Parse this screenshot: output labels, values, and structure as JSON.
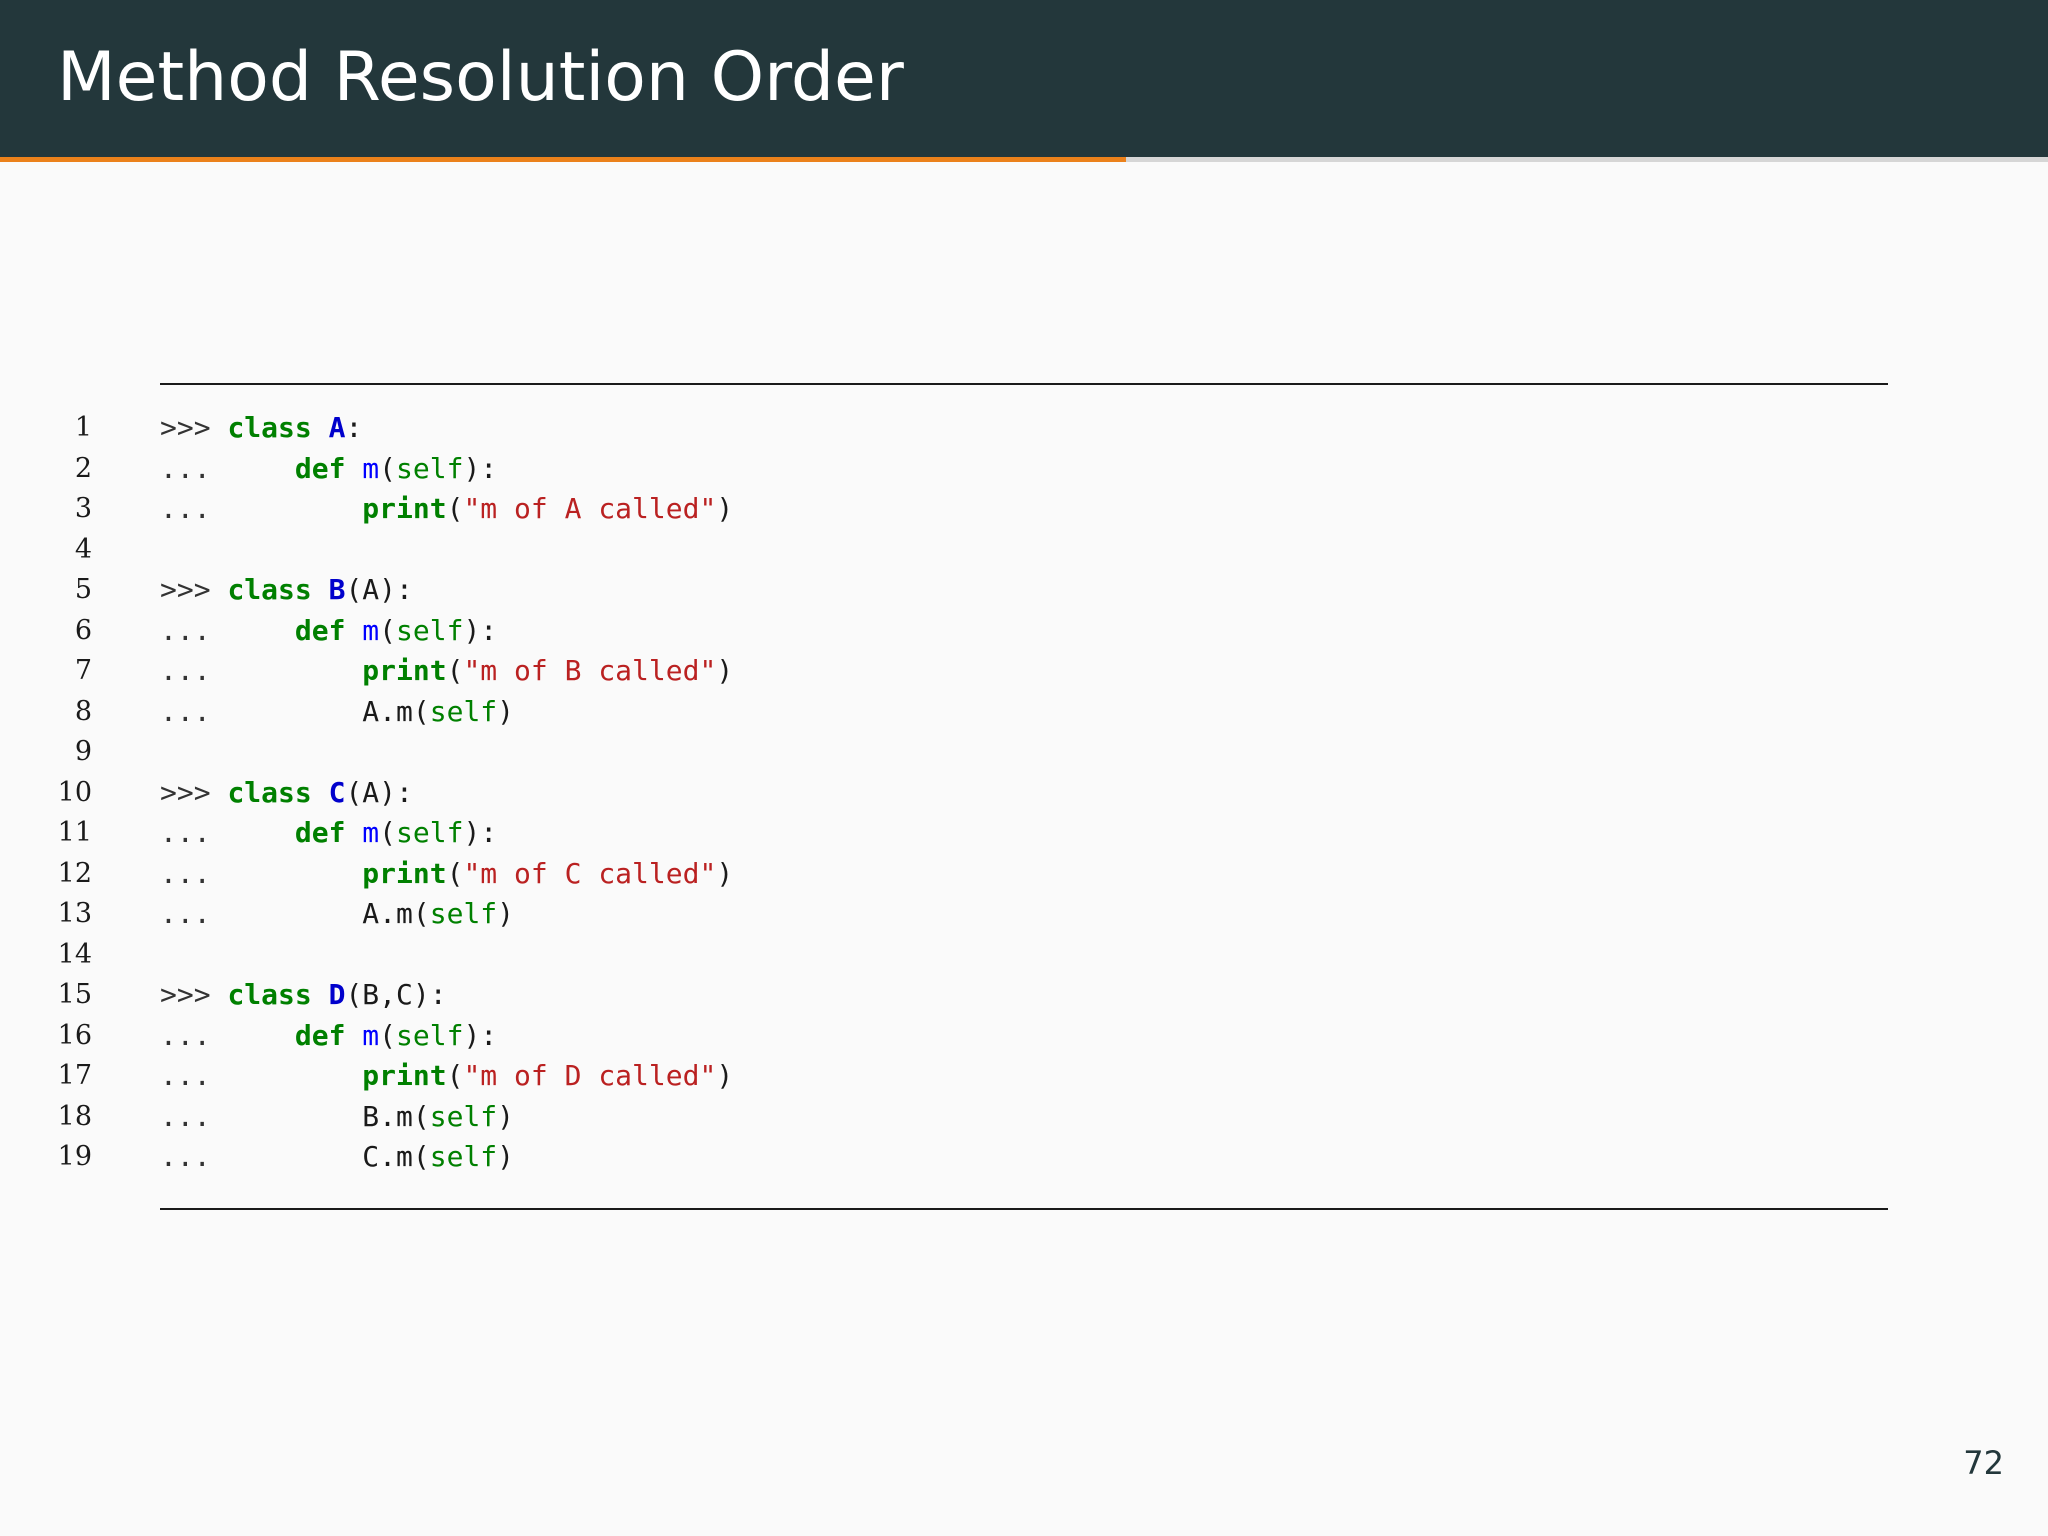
{
  "slide": {
    "title": "Method Resolution Order",
    "page_number": "72",
    "progress": 0.55,
    "colors": {
      "header_bg": "#23373b",
      "accent": "#eb811b",
      "background": "#fafafa"
    }
  },
  "code": {
    "language": "python",
    "lines": [
      {
        "num": "1",
        "tokens": [
          {
            "t": "prompt",
            "v": ">>> "
          },
          {
            "t": "kw",
            "v": "class"
          },
          {
            "t": "plain",
            "v": " "
          },
          {
            "t": "clsname",
            "v": "A"
          },
          {
            "t": "plain",
            "v": ":"
          }
        ]
      },
      {
        "num": "2",
        "tokens": [
          {
            "t": "prompt",
            "v": "...     "
          },
          {
            "t": "kw",
            "v": "def"
          },
          {
            "t": "plain",
            "v": " "
          },
          {
            "t": "name",
            "v": "m"
          },
          {
            "t": "plain",
            "v": "("
          },
          {
            "t": "builtin",
            "v": "self"
          },
          {
            "t": "plain",
            "v": "):"
          }
        ]
      },
      {
        "num": "3",
        "tokens": [
          {
            "t": "prompt",
            "v": "...         "
          },
          {
            "t": "kw",
            "v": "print"
          },
          {
            "t": "plain",
            "v": "("
          },
          {
            "t": "str",
            "v": "\"m of A called\""
          },
          {
            "t": "plain",
            "v": ")"
          }
        ]
      },
      {
        "num": "4",
        "tokens": []
      },
      {
        "num": "5",
        "tokens": [
          {
            "t": "prompt",
            "v": ">>> "
          },
          {
            "t": "kw",
            "v": "class"
          },
          {
            "t": "plain",
            "v": " "
          },
          {
            "t": "clsname",
            "v": "B"
          },
          {
            "t": "plain",
            "v": "(A):"
          }
        ]
      },
      {
        "num": "6",
        "tokens": [
          {
            "t": "prompt",
            "v": "...     "
          },
          {
            "t": "kw",
            "v": "def"
          },
          {
            "t": "plain",
            "v": " "
          },
          {
            "t": "name",
            "v": "m"
          },
          {
            "t": "plain",
            "v": "("
          },
          {
            "t": "builtin",
            "v": "self"
          },
          {
            "t": "plain",
            "v": "):"
          }
        ]
      },
      {
        "num": "7",
        "tokens": [
          {
            "t": "prompt",
            "v": "...         "
          },
          {
            "t": "kw",
            "v": "print"
          },
          {
            "t": "plain",
            "v": "("
          },
          {
            "t": "str",
            "v": "\"m of B called\""
          },
          {
            "t": "plain",
            "v": ")"
          }
        ]
      },
      {
        "num": "8",
        "tokens": [
          {
            "t": "prompt",
            "v": "...         "
          },
          {
            "t": "plain",
            "v": "A.m("
          },
          {
            "t": "builtin",
            "v": "self"
          },
          {
            "t": "plain",
            "v": ")"
          }
        ]
      },
      {
        "num": "9",
        "tokens": []
      },
      {
        "num": "10",
        "tokens": [
          {
            "t": "prompt",
            "v": ">>> "
          },
          {
            "t": "kw",
            "v": "class"
          },
          {
            "t": "plain",
            "v": " "
          },
          {
            "t": "clsname",
            "v": "C"
          },
          {
            "t": "plain",
            "v": "(A):"
          }
        ]
      },
      {
        "num": "11",
        "tokens": [
          {
            "t": "prompt",
            "v": "...     "
          },
          {
            "t": "kw",
            "v": "def"
          },
          {
            "t": "plain",
            "v": " "
          },
          {
            "t": "name",
            "v": "m"
          },
          {
            "t": "plain",
            "v": "("
          },
          {
            "t": "builtin",
            "v": "self"
          },
          {
            "t": "plain",
            "v": "):"
          }
        ]
      },
      {
        "num": "12",
        "tokens": [
          {
            "t": "prompt",
            "v": "...         "
          },
          {
            "t": "kw",
            "v": "print"
          },
          {
            "t": "plain",
            "v": "("
          },
          {
            "t": "str",
            "v": "\"m of C called\""
          },
          {
            "t": "plain",
            "v": ")"
          }
        ]
      },
      {
        "num": "13",
        "tokens": [
          {
            "t": "prompt",
            "v": "...         "
          },
          {
            "t": "plain",
            "v": "A.m("
          },
          {
            "t": "builtin",
            "v": "self"
          },
          {
            "t": "plain",
            "v": ")"
          }
        ]
      },
      {
        "num": "14",
        "tokens": []
      },
      {
        "num": "15",
        "tokens": [
          {
            "t": "prompt",
            "v": ">>> "
          },
          {
            "t": "kw",
            "v": "class"
          },
          {
            "t": "plain",
            "v": " "
          },
          {
            "t": "clsname",
            "v": "D"
          },
          {
            "t": "plain",
            "v": "(B,C):"
          }
        ]
      },
      {
        "num": "16",
        "tokens": [
          {
            "t": "prompt",
            "v": "...     "
          },
          {
            "t": "kw",
            "v": "def"
          },
          {
            "t": "plain",
            "v": " "
          },
          {
            "t": "name",
            "v": "m"
          },
          {
            "t": "plain",
            "v": "("
          },
          {
            "t": "builtin",
            "v": "self"
          },
          {
            "t": "plain",
            "v": "):"
          }
        ]
      },
      {
        "num": "17",
        "tokens": [
          {
            "t": "prompt",
            "v": "...         "
          },
          {
            "t": "kw",
            "v": "print"
          },
          {
            "t": "plain",
            "v": "("
          },
          {
            "t": "str",
            "v": "\"m of D called\""
          },
          {
            "t": "plain",
            "v": ")"
          }
        ]
      },
      {
        "num": "18",
        "tokens": [
          {
            "t": "prompt",
            "v": "...         "
          },
          {
            "t": "plain",
            "v": "B.m("
          },
          {
            "t": "builtin",
            "v": "self"
          },
          {
            "t": "plain",
            "v": ")"
          }
        ]
      },
      {
        "num": "19",
        "tokens": [
          {
            "t": "prompt",
            "v": "...         "
          },
          {
            "t": "plain",
            "v": "C.m("
          },
          {
            "t": "builtin",
            "v": "self"
          },
          {
            "t": "plain",
            "v": ")"
          }
        ]
      }
    ]
  }
}
